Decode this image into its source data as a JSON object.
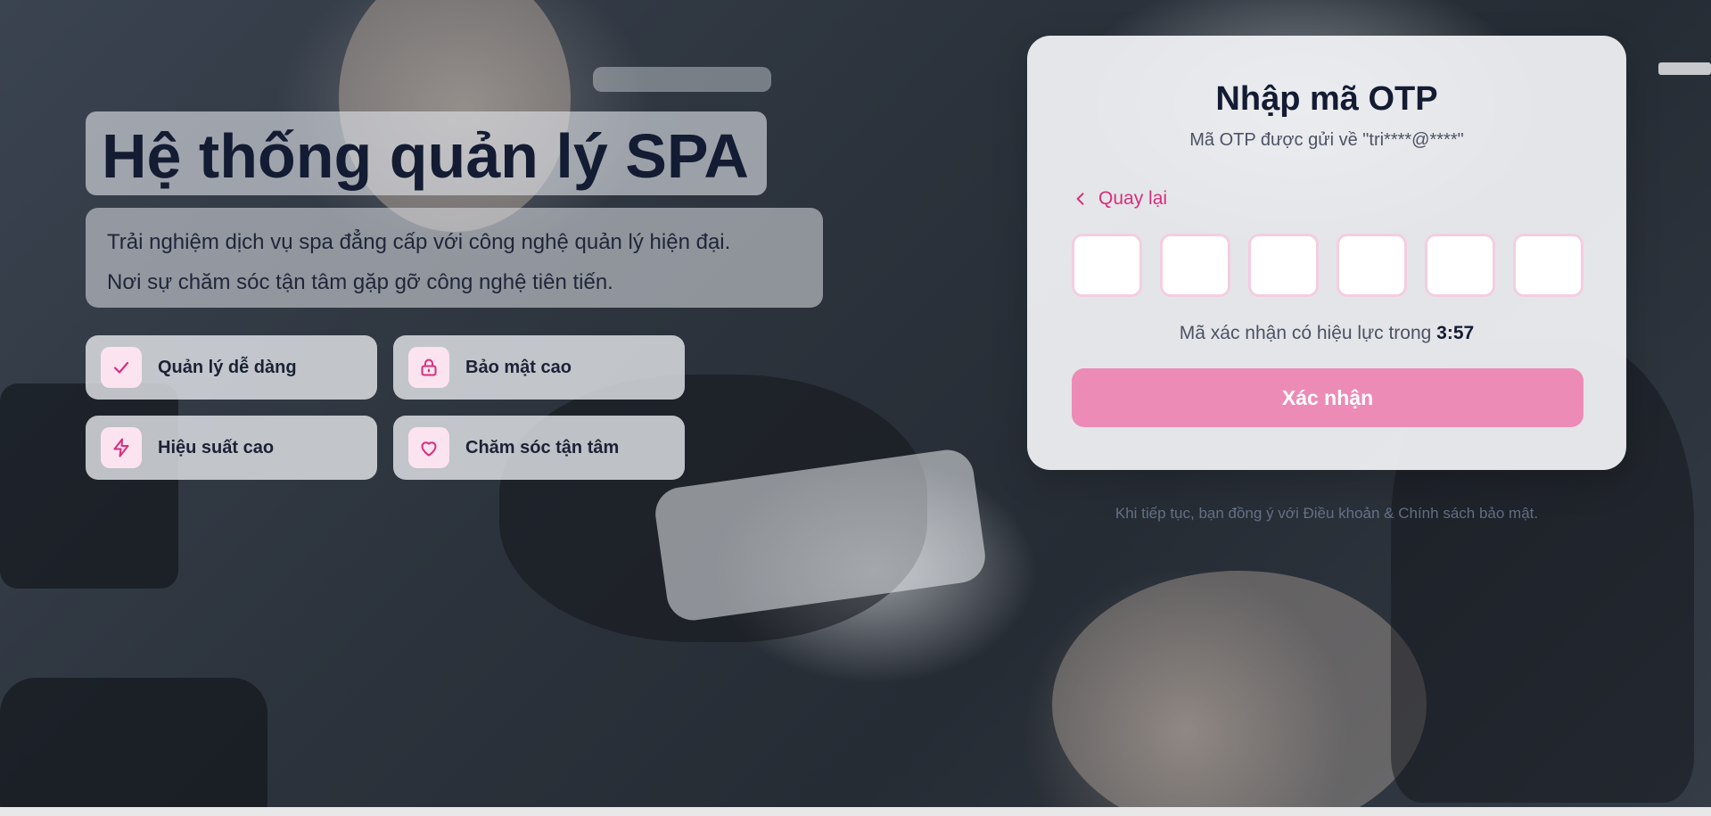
{
  "hero": {
    "title": "Hệ thống quản lý SPA",
    "subtitle_line1": "Trải nghiệm dịch vụ spa đẳng cấp với công nghệ quản lý hiện đại.",
    "subtitle_line2": "Nơi sự chăm sóc tận tâm gặp gỡ công nghệ tiên tiến."
  },
  "features": [
    {
      "label": "Quản lý dễ dàng",
      "icon": "check-icon"
    },
    {
      "label": "Bảo mật cao",
      "icon": "lock-icon"
    },
    {
      "label": "Hiệu suất cao",
      "icon": "lightning-icon"
    },
    {
      "label": "Chăm sóc tận tâm",
      "icon": "heart-icon"
    }
  ],
  "otp": {
    "title": "Nhập mã OTP",
    "subtitle": "Mã OTP được gửi về \"tri****@****\"",
    "back_label": "Quay lại",
    "digits": [
      "",
      "",
      "",
      "",
      "",
      ""
    ],
    "timer_prefix": "Mã xác nhận có hiệu lực trong",
    "timer_value": "3:57",
    "confirm_label": "Xác nhận"
  },
  "terms": "Khi tiếp tục, bạn đồng ý với Điều khoản & Chính sách bảo mật.",
  "colors": {
    "accent": "#d92e7c",
    "button": "#ed8bb7",
    "input_border": "#f5cde0",
    "icon_bg": "#fbe3ef",
    "heading": "#141c33"
  }
}
